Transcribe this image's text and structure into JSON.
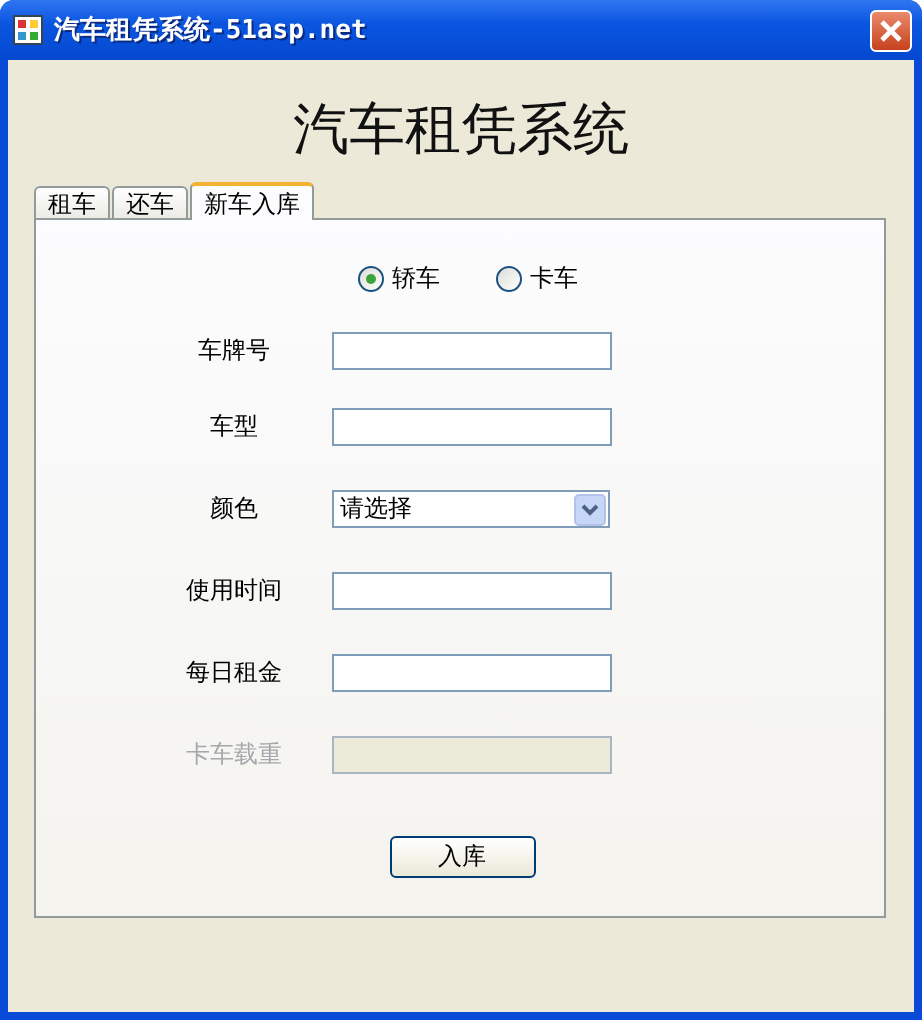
{
  "window": {
    "title": "汽车租凭系统-51asp.net"
  },
  "heading": "汽车租凭系统",
  "tabs": [
    {
      "label": "租车",
      "selected": false
    },
    {
      "label": "还车",
      "selected": false
    },
    {
      "label": "新车入库",
      "selected": true
    }
  ],
  "vehicle_type": [
    {
      "label": "轿车",
      "selected": true
    },
    {
      "label": "卡车",
      "selected": false
    }
  ],
  "fields": [
    {
      "label": "车牌号",
      "kind": "text",
      "disabled": false
    },
    {
      "label": "车型",
      "kind": "text",
      "disabled": false
    },
    {
      "label": "颜色",
      "kind": "select",
      "value": "请选择"
    },
    {
      "label": "使用时间",
      "kind": "text",
      "disabled": false
    },
    {
      "label": "每日租金",
      "kind": "text",
      "disabled": false
    },
    {
      "label": "卡车载重",
      "kind": "text",
      "disabled": true
    }
  ],
  "submit_button": "入库"
}
